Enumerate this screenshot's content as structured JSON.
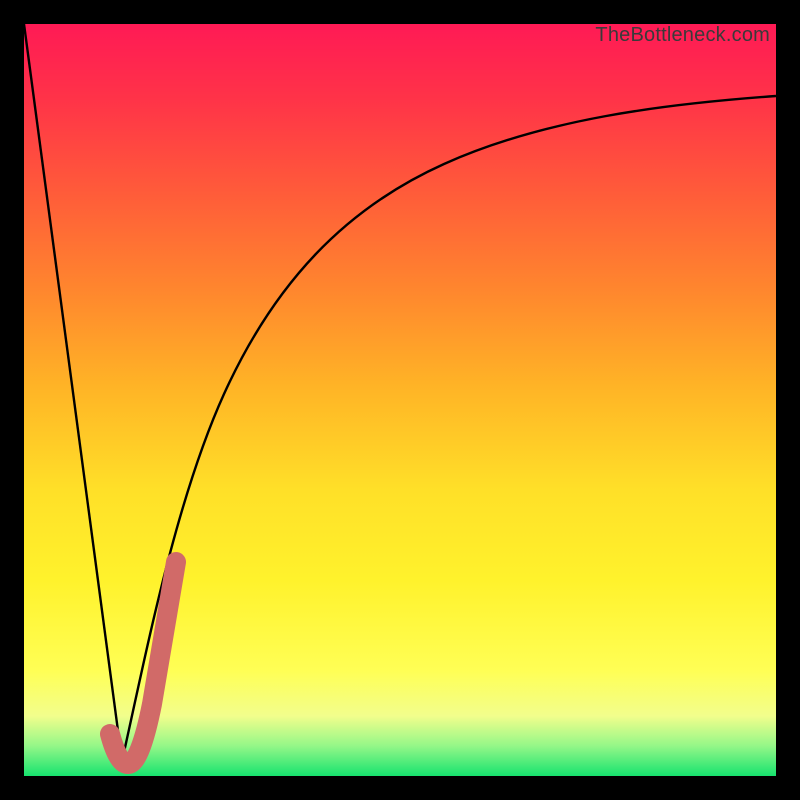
{
  "watermark": "TheBottleneck.com",
  "chart_data": {
    "type": "line",
    "title": "",
    "xlabel": "",
    "ylabel": "",
    "xlim": [
      0,
      100
    ],
    "ylim": [
      0,
      100
    ],
    "series": [
      {
        "name": "bottleneck-curve-left",
        "x": [
          0,
          13
        ],
        "y": [
          100,
          2
        ]
      },
      {
        "name": "bottleneck-curve-right",
        "x": [
          13,
          16,
          20,
          25,
          30,
          36,
          44,
          55,
          70,
          85,
          100
        ],
        "y": [
          2,
          18,
          34,
          48,
          58,
          66,
          73,
          79,
          84,
          87,
          89
        ]
      },
      {
        "name": "highlight-segment",
        "x": [
          12,
          13,
          14,
          17,
          20
        ],
        "y": [
          6,
          2,
          2,
          16,
          30
        ]
      }
    ],
    "colors": {
      "curve": "#000000",
      "highlight": "#d16a68"
    },
    "background_gradient": {
      "top": "#ff1a55",
      "mid_upper": "#ff852e",
      "mid": "#ffe028",
      "mid_lower": "#ffff55",
      "bottom": "#17e36f"
    }
  }
}
